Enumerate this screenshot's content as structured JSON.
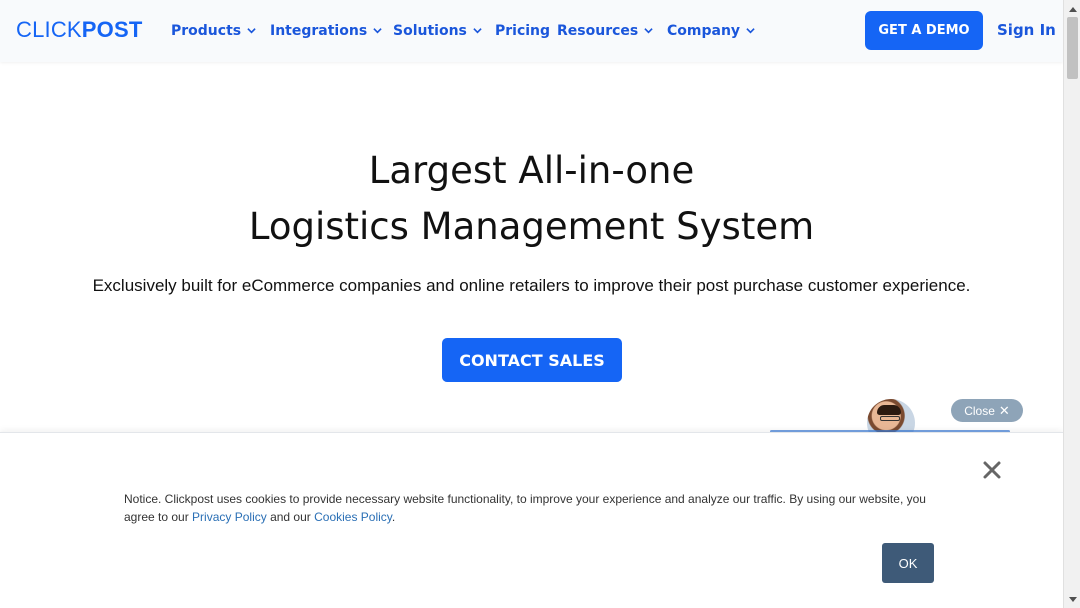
{
  "brand": {
    "logo_light": "CLICK",
    "logo_bold": "POST",
    "accent": "#1565f5"
  },
  "nav": {
    "items": [
      {
        "label": "Products",
        "dropdown": true
      },
      {
        "label": "Integrations",
        "dropdown": true
      },
      {
        "label": "Solutions",
        "dropdown": true
      },
      {
        "label": "Pricing",
        "dropdown": false
      },
      {
        "label": "Resources",
        "dropdown": true
      },
      {
        "label": "Company",
        "dropdown": true
      }
    ],
    "demo_label": "GET A DEMO",
    "signin_label": "Sign In"
  },
  "hero": {
    "title_line1": "Largest All-in-one",
    "title_line2": "Logistics Management System",
    "subtitle": "Exclusively built for eCommerce companies and online retailers to improve their post purchase customer experience.",
    "cta_label": "CONTACT SALES"
  },
  "chat": {
    "close_label": "Close",
    "avatar_icon": "support-agent-avatar"
  },
  "cookie": {
    "text_before": "Notice. Clickpost uses cookies to provide necessary website functionality, to improve your experience and analyze our traffic. By using our website, you agree to our ",
    "privacy_link": "Privacy Policy",
    "text_middle": " and our ",
    "cookies_link": "Cookies Policy",
    "text_after": ".",
    "ok_label": "OK",
    "close_icon": "close-icon"
  },
  "scrollbar": {
    "up_icon": "triangle-up-icon",
    "down_icon": "triangle-down-icon"
  }
}
